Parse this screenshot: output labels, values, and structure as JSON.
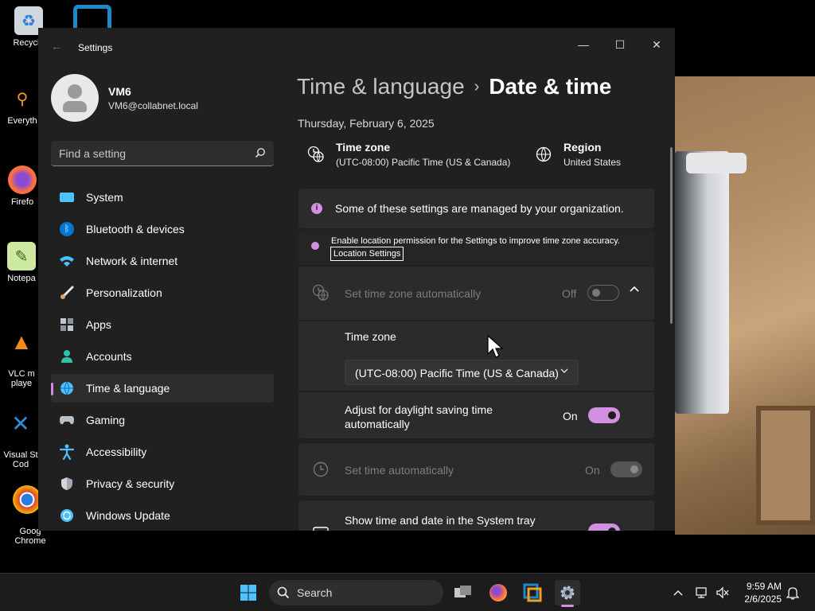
{
  "desktop": {
    "icons": [
      {
        "label": "Recycle",
        "name": "recycle-bin-icon"
      },
      {
        "label": "Everyth",
        "name": "everything-icon"
      },
      {
        "label": "Firefo",
        "name": "firefox-desktop-icon"
      },
      {
        "label": "Notepa",
        "name": "notepad-icon"
      },
      {
        "label": "VLC m\nplaye",
        "name": "vlc-icon"
      },
      {
        "label": "Visual St\nCod",
        "name": "vscode-icon"
      },
      {
        "label": "Goog\nChrome",
        "name": "chrome-icon"
      }
    ]
  },
  "window": {
    "title": "Settings",
    "minimize": "—",
    "maximize": "☐",
    "close": "✕",
    "back": "←"
  },
  "user": {
    "name": "VM6",
    "email": "VM6@collabnet.local"
  },
  "search": {
    "placeholder": "Find a setting"
  },
  "nav": [
    {
      "label": "System",
      "icon": "system-icon",
      "color": "#4cc2ff"
    },
    {
      "label": "Bluetooth & devices",
      "icon": "bluetooth-icon",
      "color": "#0078d4"
    },
    {
      "label": "Network & internet",
      "icon": "wifi-icon",
      "color": "#4cc2ff"
    },
    {
      "label": "Personalization",
      "icon": "brush-icon",
      "color": "#e0a060"
    },
    {
      "label": "Apps",
      "icon": "apps-icon",
      "color": "#9aa4b1"
    },
    {
      "label": "Accounts",
      "icon": "accounts-icon",
      "color": "#2ec4a5"
    },
    {
      "label": "Time & language",
      "icon": "globe-clock-icon",
      "color": "#4cc2ff",
      "selected": true
    },
    {
      "label": "Gaming",
      "icon": "controller-icon",
      "color": "#9aa4b1"
    },
    {
      "label": "Accessibility",
      "icon": "accessibility-icon",
      "color": "#4cc2ff"
    },
    {
      "label": "Privacy & security",
      "icon": "shield-icon",
      "color": "#a0a8b0"
    },
    {
      "label": "Windows Update",
      "icon": "update-icon",
      "color": "#4cc2ff"
    }
  ],
  "content": {
    "breadcrumb_parent": "Time & language",
    "breadcrumb_sep": "›",
    "breadcrumb_current": "Date & time",
    "date": "Thursday, February 6, 2025",
    "timezone_title": "Time zone",
    "timezone_value": "(UTC-08:00) Pacific Time (US & Canada)",
    "region_title": "Region",
    "region_value": "United States",
    "managed_notice": "Some of these settings are managed by your organization.",
    "location_notice": "Enable location permission for the Settings to improve time zone accuracy.",
    "location_link": "Location Settings",
    "auto_tz_label": "Set time zone automatically",
    "auto_tz_state": "Off",
    "tz_label": "Time zone",
    "tz_select": "(UTC-08:00) Pacific Time (US & Canada)",
    "dst_label": "Adjust for daylight saving time automatically",
    "dst_state": "On",
    "auto_time_label": "Set time automatically",
    "auto_time_state": "On",
    "tray_label": "Show time and date in the System tray"
  },
  "taskbar": {
    "search_label": "Search",
    "time": "9:59 AM",
    "date": "2/6/2025"
  },
  "colors": {
    "accent": "#d38fe0",
    "window_bg": "#202020",
    "card_bg": "#2b2b2b"
  }
}
